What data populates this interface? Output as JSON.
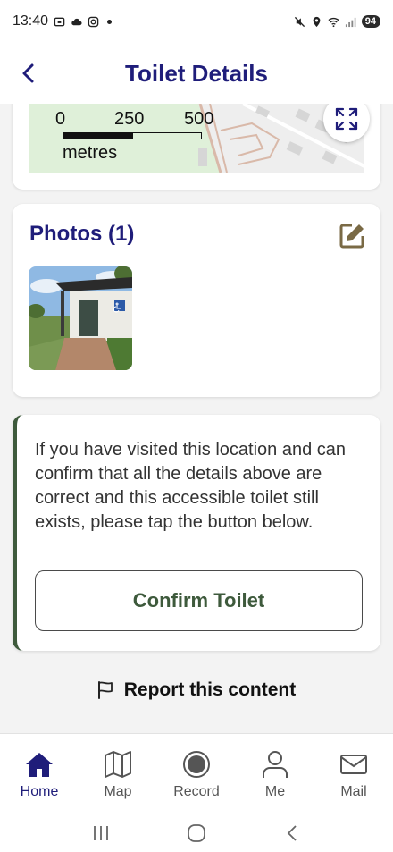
{
  "status_bar": {
    "time": "13:40",
    "battery": "94"
  },
  "header": {
    "title": "Toilet Details"
  },
  "map": {
    "scale_labels": [
      "0",
      "250",
      "500"
    ],
    "scale_unit": "metres"
  },
  "photos": {
    "title": "Photos (1)"
  },
  "confirm": {
    "text": "If you have visited this location and can confirm that all the details above are correct and this accessible toilet still exists, please tap the button below.",
    "button_label": "Confirm Toilet"
  },
  "report": {
    "label": "Report this content"
  },
  "nav": {
    "items": [
      {
        "label": "Home"
      },
      {
        "label": "Map"
      },
      {
        "label": "Record"
      },
      {
        "label": "Me"
      },
      {
        "label": "Mail"
      }
    ]
  },
  "colors": {
    "title": "#1f1d7a",
    "accent_green": "#3e5a3c",
    "edit_icon": "#7a6a45"
  },
  "icons": [
    "back-arrow-icon",
    "expand-icon",
    "edit-icon",
    "flag-icon",
    "home-icon",
    "map-icon",
    "record-icon",
    "person-icon",
    "mail-icon"
  ]
}
